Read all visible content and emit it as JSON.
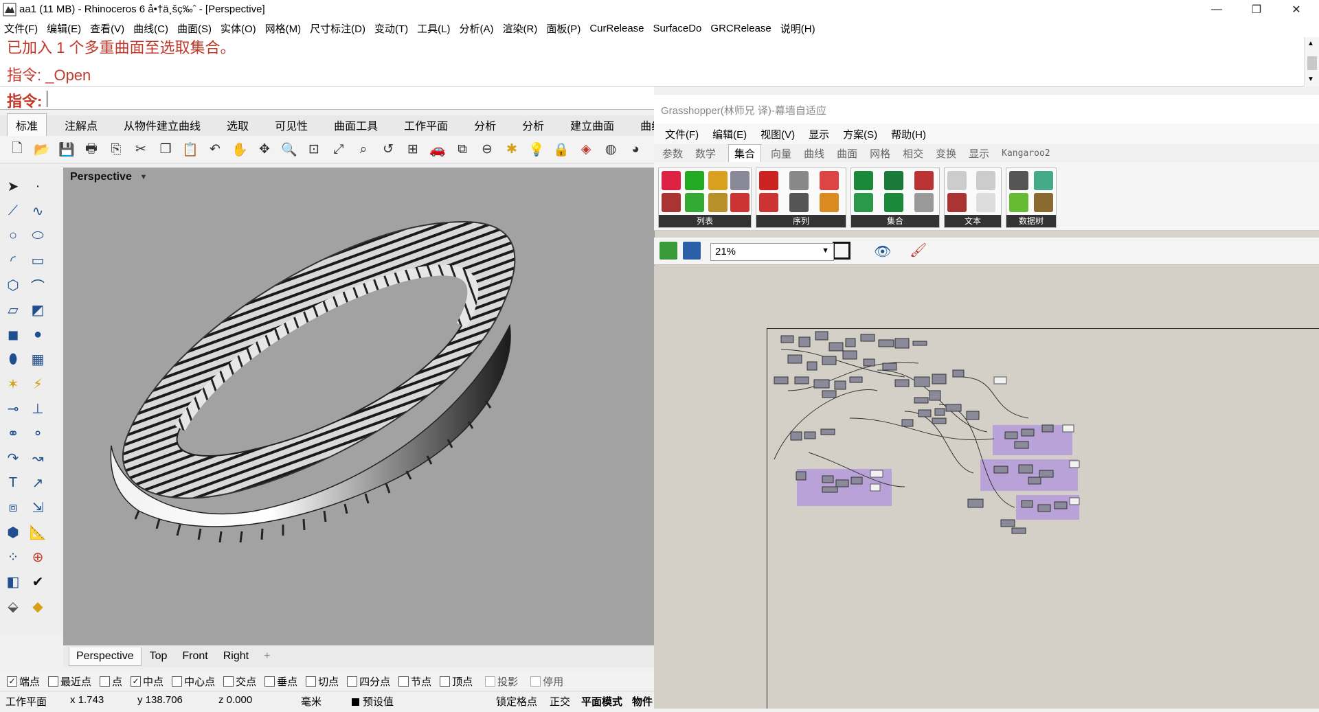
{
  "window": {
    "title": "aa1 (11 MB) - Rhinoceros 6 å•†ä¸šç‰ˆ - [Perspective]",
    "minimize_glyph": "—",
    "restore_glyph": "❐",
    "close_glyph": "✕"
  },
  "menubar": [
    "文件(F)",
    "编辑(E)",
    "查看(V)",
    "曲线(C)",
    "曲面(S)",
    "实体(O)",
    "网格(M)",
    "尺寸标注(D)",
    "变动(T)",
    "工具(L)",
    "分析(A)",
    "渲染(R)",
    "面板(P)",
    "CurRelease",
    "SurfaceDo",
    "GRCRelease",
    "说明(H)"
  ],
  "command": {
    "history_1": "已加入 1 个多重曲面至选取集合。",
    "history_2": "指令: _Open",
    "prompt": "指令:"
  },
  "rhino_tabs": [
    "标准",
    "注解点",
    "从物件建立曲线",
    "选取",
    "可见性",
    "曲面工具",
    "工作平面",
    "分析",
    "分析",
    "建立曲面",
    "曲线"
  ],
  "viewport": {
    "name": "Perspective",
    "tabs": [
      "Perspective",
      "Top",
      "Front",
      "Right"
    ],
    "add_tab": "+"
  },
  "osnaps": [
    {
      "label": "端点",
      "checked": true,
      "disabled": false
    },
    {
      "label": "最近点",
      "checked": false,
      "disabled": false
    },
    {
      "label": "点",
      "checked": false,
      "disabled": false
    },
    {
      "label": "中点",
      "checked": true,
      "disabled": false
    },
    {
      "label": "中心点",
      "checked": false,
      "disabled": false
    },
    {
      "label": "交点",
      "checked": false,
      "disabled": false
    },
    {
      "label": "垂点",
      "checked": false,
      "disabled": false
    },
    {
      "label": "切点",
      "checked": false,
      "disabled": false
    },
    {
      "label": "四分点",
      "checked": false,
      "disabled": false
    },
    {
      "label": "节点",
      "checked": false,
      "disabled": false
    },
    {
      "label": "顶点",
      "checked": false,
      "disabled": false
    },
    {
      "label": "投影",
      "checked": false,
      "disabled": true
    },
    {
      "label": "停用",
      "checked": false,
      "disabled": true
    }
  ],
  "status": {
    "cplane": "工作平面",
    "x": "x 1.743",
    "y": "y 138.706",
    "z": "z 0.000",
    "units": "毫米",
    "layer": "预设值",
    "grid_snap": "锁定格点",
    "ortho": "正交",
    "planar": "平面模式",
    "osnap": "物件"
  },
  "grasshopper": {
    "title": "Grasshopper(林师兄 译)-幕墙自适应",
    "menu": [
      "文件(F)",
      "编辑(E)",
      "视图(V)",
      "显示",
      "方案(S)",
      "帮助(H)"
    ],
    "tabs": [
      "参数",
      "数学",
      "集合",
      "向量",
      "曲线",
      "曲面",
      "网格",
      "相交",
      "变换",
      "显示",
      "Kangaroo2"
    ],
    "active_tab": "集合",
    "groups": [
      "列表",
      "序列",
      "集合",
      "文本",
      "数据树"
    ],
    "zoom": "21%"
  }
}
